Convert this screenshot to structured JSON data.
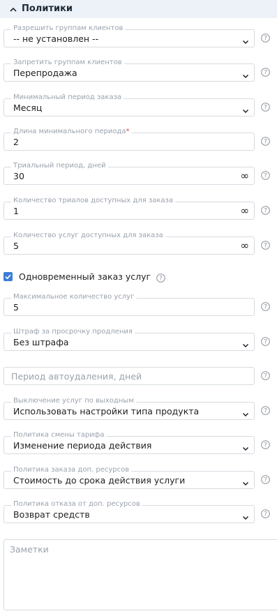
{
  "section": {
    "title": "Политики",
    "icon": "chevron-up-icon"
  },
  "fields": {
    "allow_groups": {
      "label": "Разрешить группам клиентов",
      "value": "-- не установлен --"
    },
    "deny_groups": {
      "label": "Запретить группам клиентов",
      "value": "Перепродажа"
    },
    "min_order_period": {
      "label": "Минимальный период заказа",
      "value": "Месяц"
    },
    "min_period_length": {
      "label": "Длина минимального периода",
      "required_mark": "*",
      "value": "2"
    },
    "trial_period": {
      "label": "Триальный период, дней",
      "value": "30",
      "suffix": "∞"
    },
    "trials_count": {
      "label": "Количество триалов доступных для заказа",
      "value": "1",
      "suffix": "∞"
    },
    "services_count": {
      "label": "Количество услуг доступных для заказа",
      "value": "5",
      "suffix": "∞"
    },
    "simultaneous": {
      "label": "Одновременный заказ услуг",
      "checked": true
    },
    "max_services": {
      "label": "Максимальное количество услуг",
      "value": "5"
    },
    "renewal_penalty": {
      "label": "Штраф за просрочку продления",
      "value": "Без штрафа"
    },
    "autodelete_period": {
      "placeholder": "Период автоудаления, дней"
    },
    "weekend_shutdown": {
      "label": "Выключение услуг по выходным",
      "value": "Использовать настройки типа продукта"
    },
    "tariff_change": {
      "label": "Политика смены тарифа",
      "value": "Изменение периода действия"
    },
    "addon_order": {
      "label": "Политика заказа доп. ресурсов",
      "value": "Стоимость до срока действия услуги"
    },
    "addon_refusal": {
      "label": "Политика отказа от доп. ресурсов",
      "value": "Возврат средств"
    },
    "notes": {
      "placeholder": "Заметки"
    }
  },
  "colors": {
    "accent": "#3b7dd8",
    "header_bg": "#edf2f8",
    "border": "#d7dbe0",
    "muted": "#9aa2ad",
    "required": "#e0464b"
  }
}
